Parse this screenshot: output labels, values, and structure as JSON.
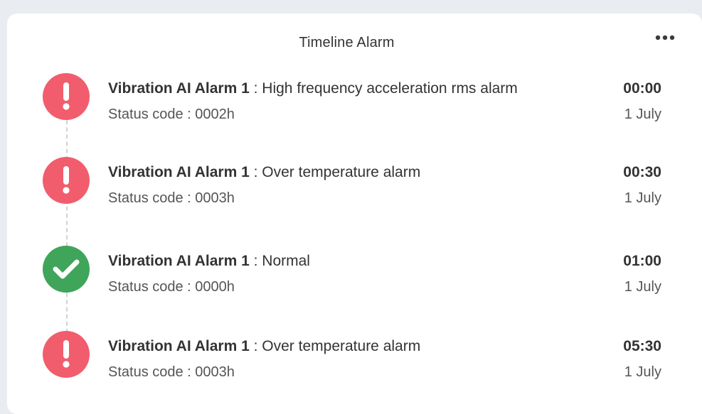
{
  "widget": {
    "title": "Timeline Alarm",
    "more_icon": "more-horizontal-icon"
  },
  "events": [
    {
      "name": "Vibration AI Alarm 1",
      "separator": " : ",
      "description": "High frequency acceleration rms alarm",
      "status_text": "Status code : 0002h",
      "time": "00:00",
      "date": "1 July",
      "icon": "exclamation-icon",
      "state": "alarm",
      "color": "#f15d6d"
    },
    {
      "name": "Vibration AI Alarm 1",
      "separator": " : ",
      "description": "Over temperature alarm",
      "status_text": "Status code : 0003h",
      "time": "00:30",
      "date": "1 July",
      "icon": "exclamation-icon",
      "state": "alarm",
      "color": "#f15d6d"
    },
    {
      "name": "Vibration AI Alarm 1",
      "separator": " : ",
      "description": "Normal",
      "status_text": "Status code : 0000h",
      "time": "01:00",
      "date": "1 July",
      "icon": "checkmark-icon",
      "state": "normal",
      "color": "#3fa55a"
    },
    {
      "name": "Vibration AI Alarm 1",
      "separator": " : ",
      "description": "Over temperature alarm",
      "status_text": "Status code : 0003h",
      "time": "05:30",
      "date": "1 July",
      "icon": "exclamation-icon",
      "state": "alarm",
      "color": "#f15d6d"
    }
  ]
}
